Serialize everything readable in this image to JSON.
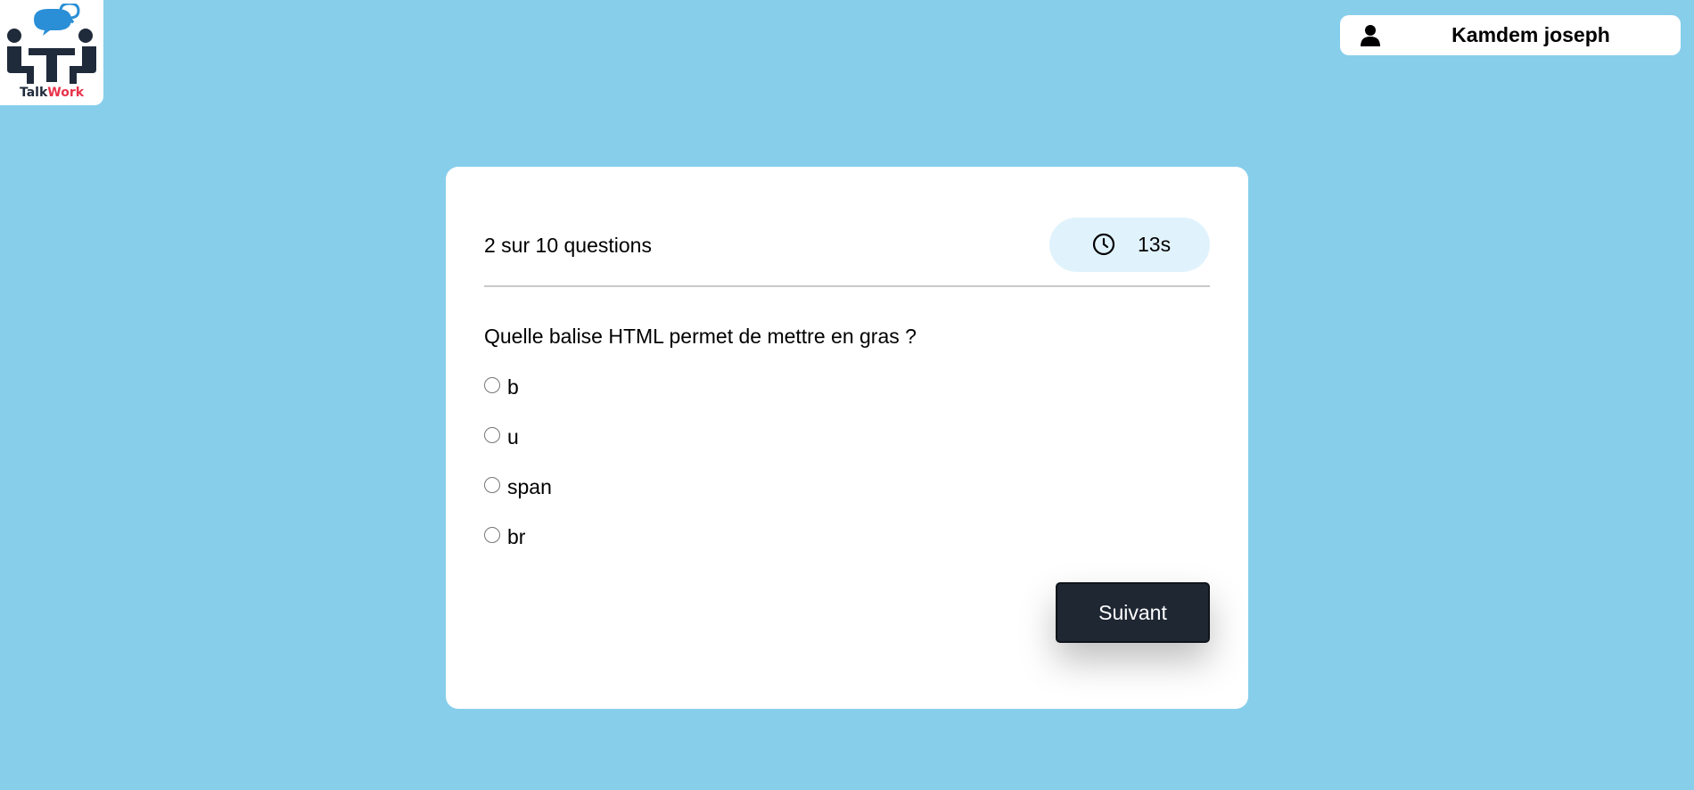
{
  "logo": {
    "part1": "Talk",
    "part2": "Work",
    "brand_dark": "#1f2a3a",
    "brand_red": "#e8334a",
    "bubble_blue": "#2a8fd6"
  },
  "user": {
    "name": "Kamdem joseph",
    "icon": "user-icon"
  },
  "quiz": {
    "progress_text": "2 sur 10 questions",
    "current_question": 2,
    "total_questions": 10,
    "timer": {
      "icon": "clock-icon",
      "value": "13s"
    },
    "question": "Quelle balise HTML permet de mettre en gras ?",
    "options": [
      {
        "label": "b",
        "selected": false
      },
      {
        "label": "u",
        "selected": false
      },
      {
        "label": "span",
        "selected": false
      },
      {
        "label": "br",
        "selected": false
      }
    ],
    "next_label": "Suivant"
  },
  "colors": {
    "background": "#87ceeb",
    "card": "#ffffff",
    "timer_bg": "#e0f3fc",
    "button_bg": "#1f2733"
  }
}
